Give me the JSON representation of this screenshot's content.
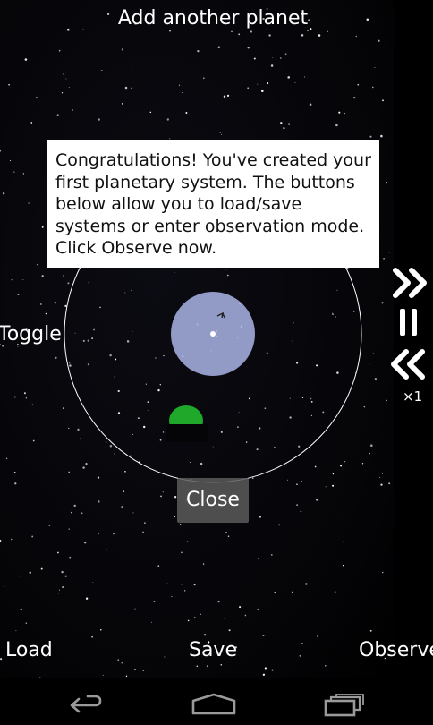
{
  "top": {
    "add_planet_label": "Add another planet"
  },
  "side": {
    "toggle_label": "Toggle",
    "speed_multiplier": "×1",
    "fast_forward_icon": "fast-forward-icon",
    "pause_icon": "pause-icon",
    "rewind_icon": "rewind-icon"
  },
  "tooltip": {
    "message": "Congratulations! You've created your first planetary system. The buttons below allow you to load/save systems or enter observation mode. Click Observe now."
  },
  "dialog": {
    "close_label": "Close"
  },
  "bottom_bar": {
    "load_label": "Load",
    "save_label": "Save",
    "observe_label": "Observe"
  },
  "system_nav": {
    "back_icon": "back-icon",
    "home_icon": "home-icon",
    "recents_icon": "recents-icon"
  },
  "colors": {
    "orbit": "#ffffff",
    "star_fill": "#aab4e6",
    "planet_fill": "#1fa82a",
    "tooltip_bg": "#ffffff",
    "close_bg": "#5a5a5a"
  }
}
